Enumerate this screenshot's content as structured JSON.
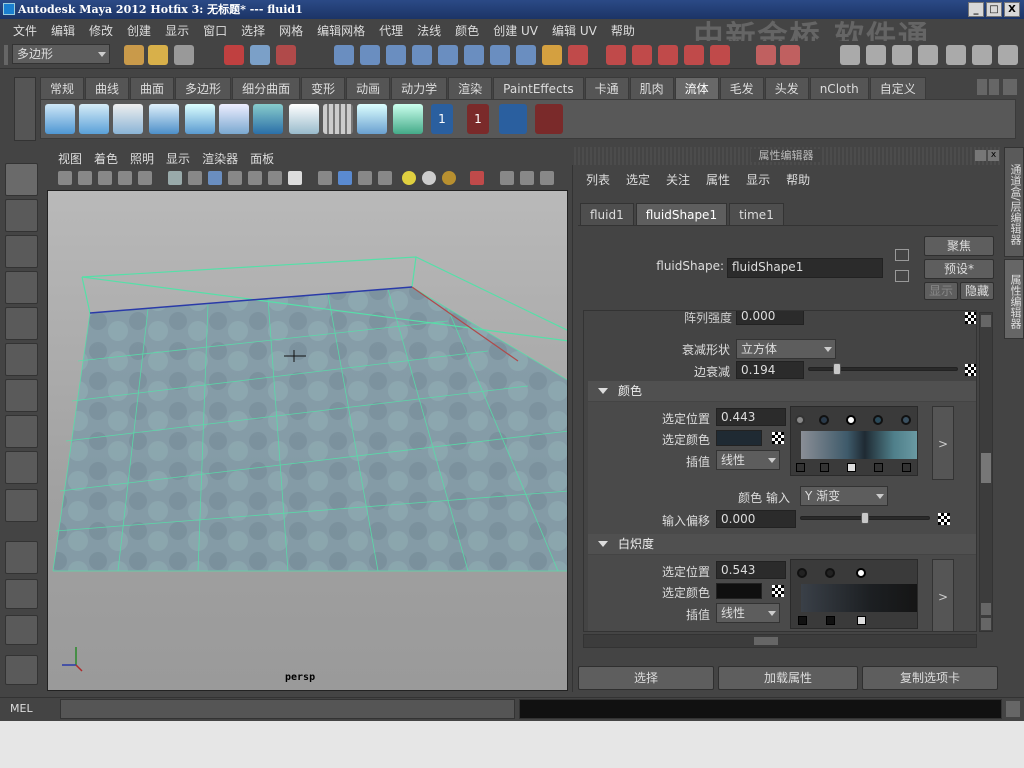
{
  "window": {
    "title": "Autodesk Maya 2012 Hotfix 3: 无标题*   ---   fluid1",
    "controls": [
      "_",
      "□",
      "X"
    ]
  },
  "watermark": "中新金桥 软件通",
  "menubar": [
    "文件",
    "编辑",
    "修改",
    "创建",
    "显示",
    "窗口",
    "选择",
    "网格",
    "编辑网格",
    "代理",
    "法线",
    "颜色",
    "创建 UV",
    "编辑 UV",
    "帮助"
  ],
  "statusline": {
    "mode_dropdown": "多边形"
  },
  "shelf": {
    "tabs": [
      "常规",
      "曲线",
      "曲面",
      "多边形",
      "细分曲面",
      "变形",
      "动画",
      "动力学",
      "渲染",
      "PaintEffects",
      "卡通",
      "肌肉",
      "流体",
      "毛发",
      "头发",
      "nCloth",
      "自定义"
    ],
    "active_tab": "流体"
  },
  "viewport": {
    "menu": [
      "视图",
      "着色",
      "照明",
      "显示",
      "渲染器",
      "面板"
    ],
    "camera_label": "persp"
  },
  "attribute_editor": {
    "title": "属性编辑器",
    "menu": [
      "列表",
      "选定",
      "关注",
      "属性",
      "显示",
      "帮助"
    ],
    "tabs": [
      "fluid1",
      "fluidShape1",
      "time1"
    ],
    "active_tab": "fluidShape1",
    "node_label": "fluidShape:",
    "node_name": "fluidShape1",
    "buttons": {
      "focus": "聚焦",
      "presets": "预设*",
      "show": "显示",
      "hide": "隐藏"
    },
    "partial_row": {
      "label": "阵列强度",
      "value": "0.000"
    },
    "falloff_shape": {
      "label": "衰减形状",
      "value": "立方体"
    },
    "edge_dropoff": {
      "label": "边衰减",
      "value": "0.194",
      "slider": 0.194
    },
    "color_section": {
      "title": "颜色",
      "selected_position_label": "选定位置",
      "selected_position": "0.443",
      "selected_color_label": "选定颜色",
      "selected_color": "#1f2a33",
      "interp_label": "插值",
      "interp_value": "线性",
      "input_label": "颜色 输入",
      "input_value": "Y 渐变",
      "bias_label": "输入偏移",
      "bias_value": "0.000",
      "bias_slider": 0.5,
      "expand": ">"
    },
    "incandescence_section": {
      "title": "白炽度",
      "selected_position_label": "选定位置",
      "selected_position": "0.543",
      "selected_color_label": "选定颜色",
      "selected_color": "#0f0f0f",
      "interp_label": "插值",
      "interp_value": "线性",
      "expand": ">"
    },
    "bottom_buttons": [
      "选择",
      "加载属性",
      "复制选项卡"
    ]
  },
  "right_tabs": [
    "通道盒/层编辑器",
    "属性编辑器"
  ],
  "command_line": {
    "label": "MEL"
  },
  "colors": {
    "accent_blue": "#2b4a86",
    "panel": "#444444",
    "grid": "#55e0a8"
  }
}
